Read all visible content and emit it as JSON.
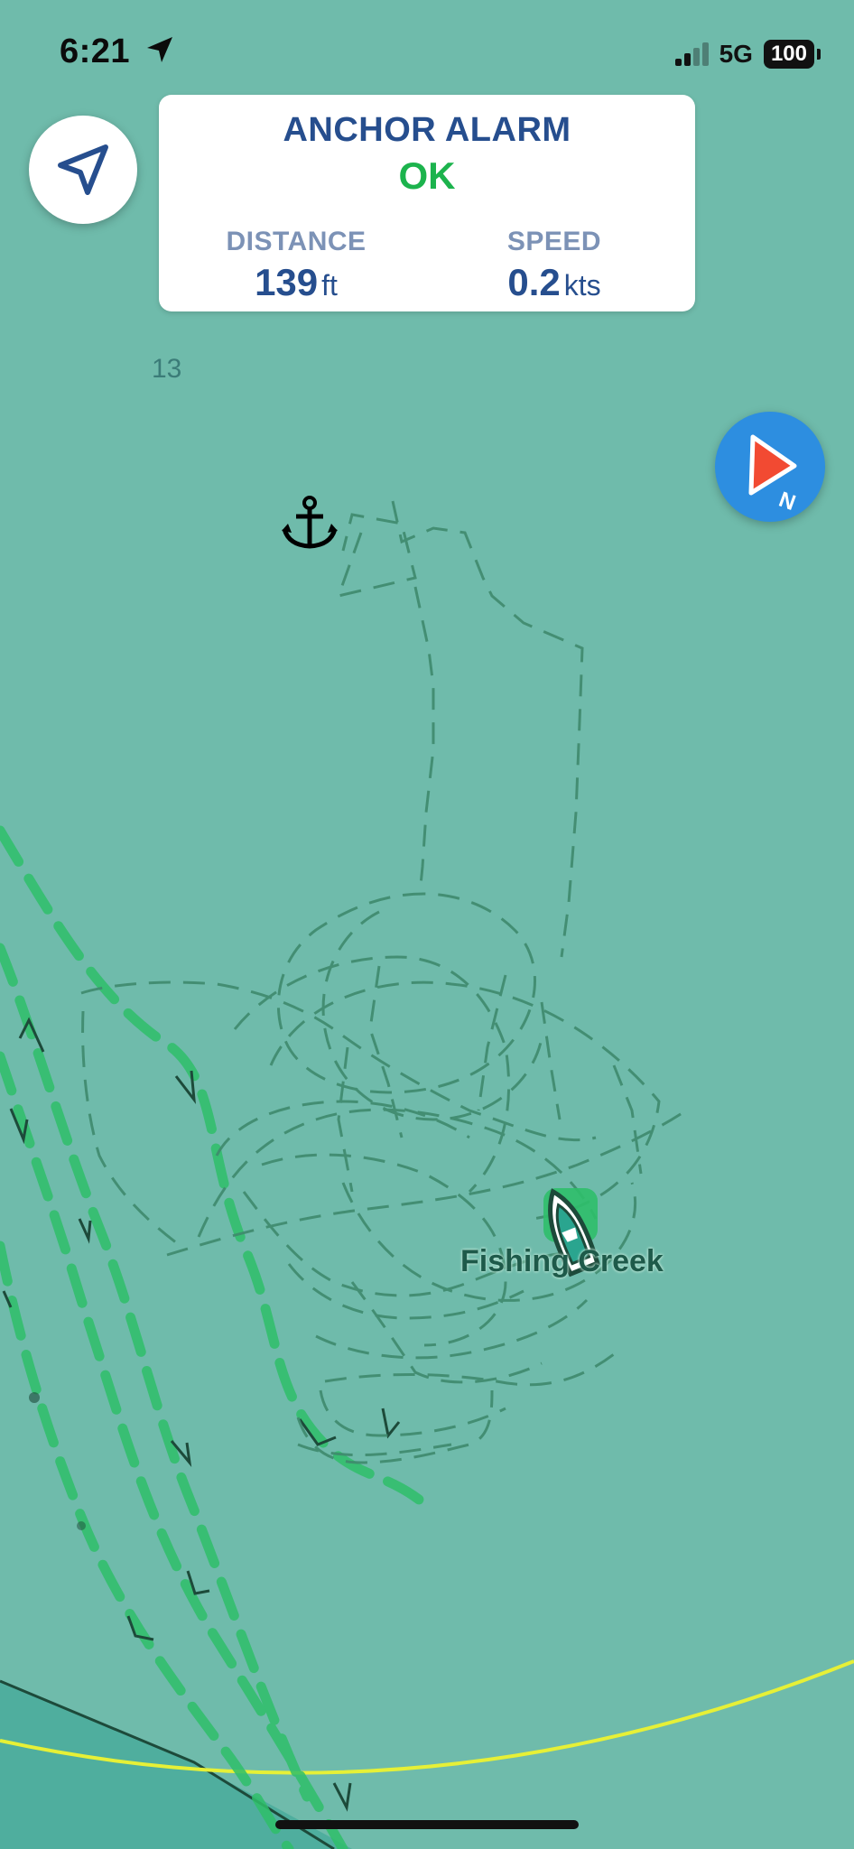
{
  "status_bar": {
    "time": "6:21",
    "network": "5G",
    "battery": "100",
    "location_icon": "location-arrow-icon",
    "signal_icon": "signal-bars-icon"
  },
  "locate_button": {
    "icon": "navigation-arrow-icon"
  },
  "anchor_alarm": {
    "title": "ANCHOR ALARM",
    "status": "OK",
    "distance": {
      "label": "DISTANCE",
      "value": "139",
      "unit": "ft"
    },
    "speed": {
      "label": "SPEED",
      "value": "0.2",
      "unit": "kts"
    }
  },
  "compass_button": {
    "icon": "north-compass-icon",
    "label": "N"
  },
  "map": {
    "depth_sounding": "13",
    "place_name": "Fishing Creek",
    "anchor_icon": "anchor-icon",
    "boat_icon": "boat-icon",
    "colors": {
      "water": "#6fbbab",
      "track": "#3f8a6d",
      "route": "#2fbf6a",
      "alarm_circle": "#e6f037",
      "accent": "#264e8e",
      "ok": "#1cb34d",
      "compass": "#2d8ee0"
    }
  }
}
